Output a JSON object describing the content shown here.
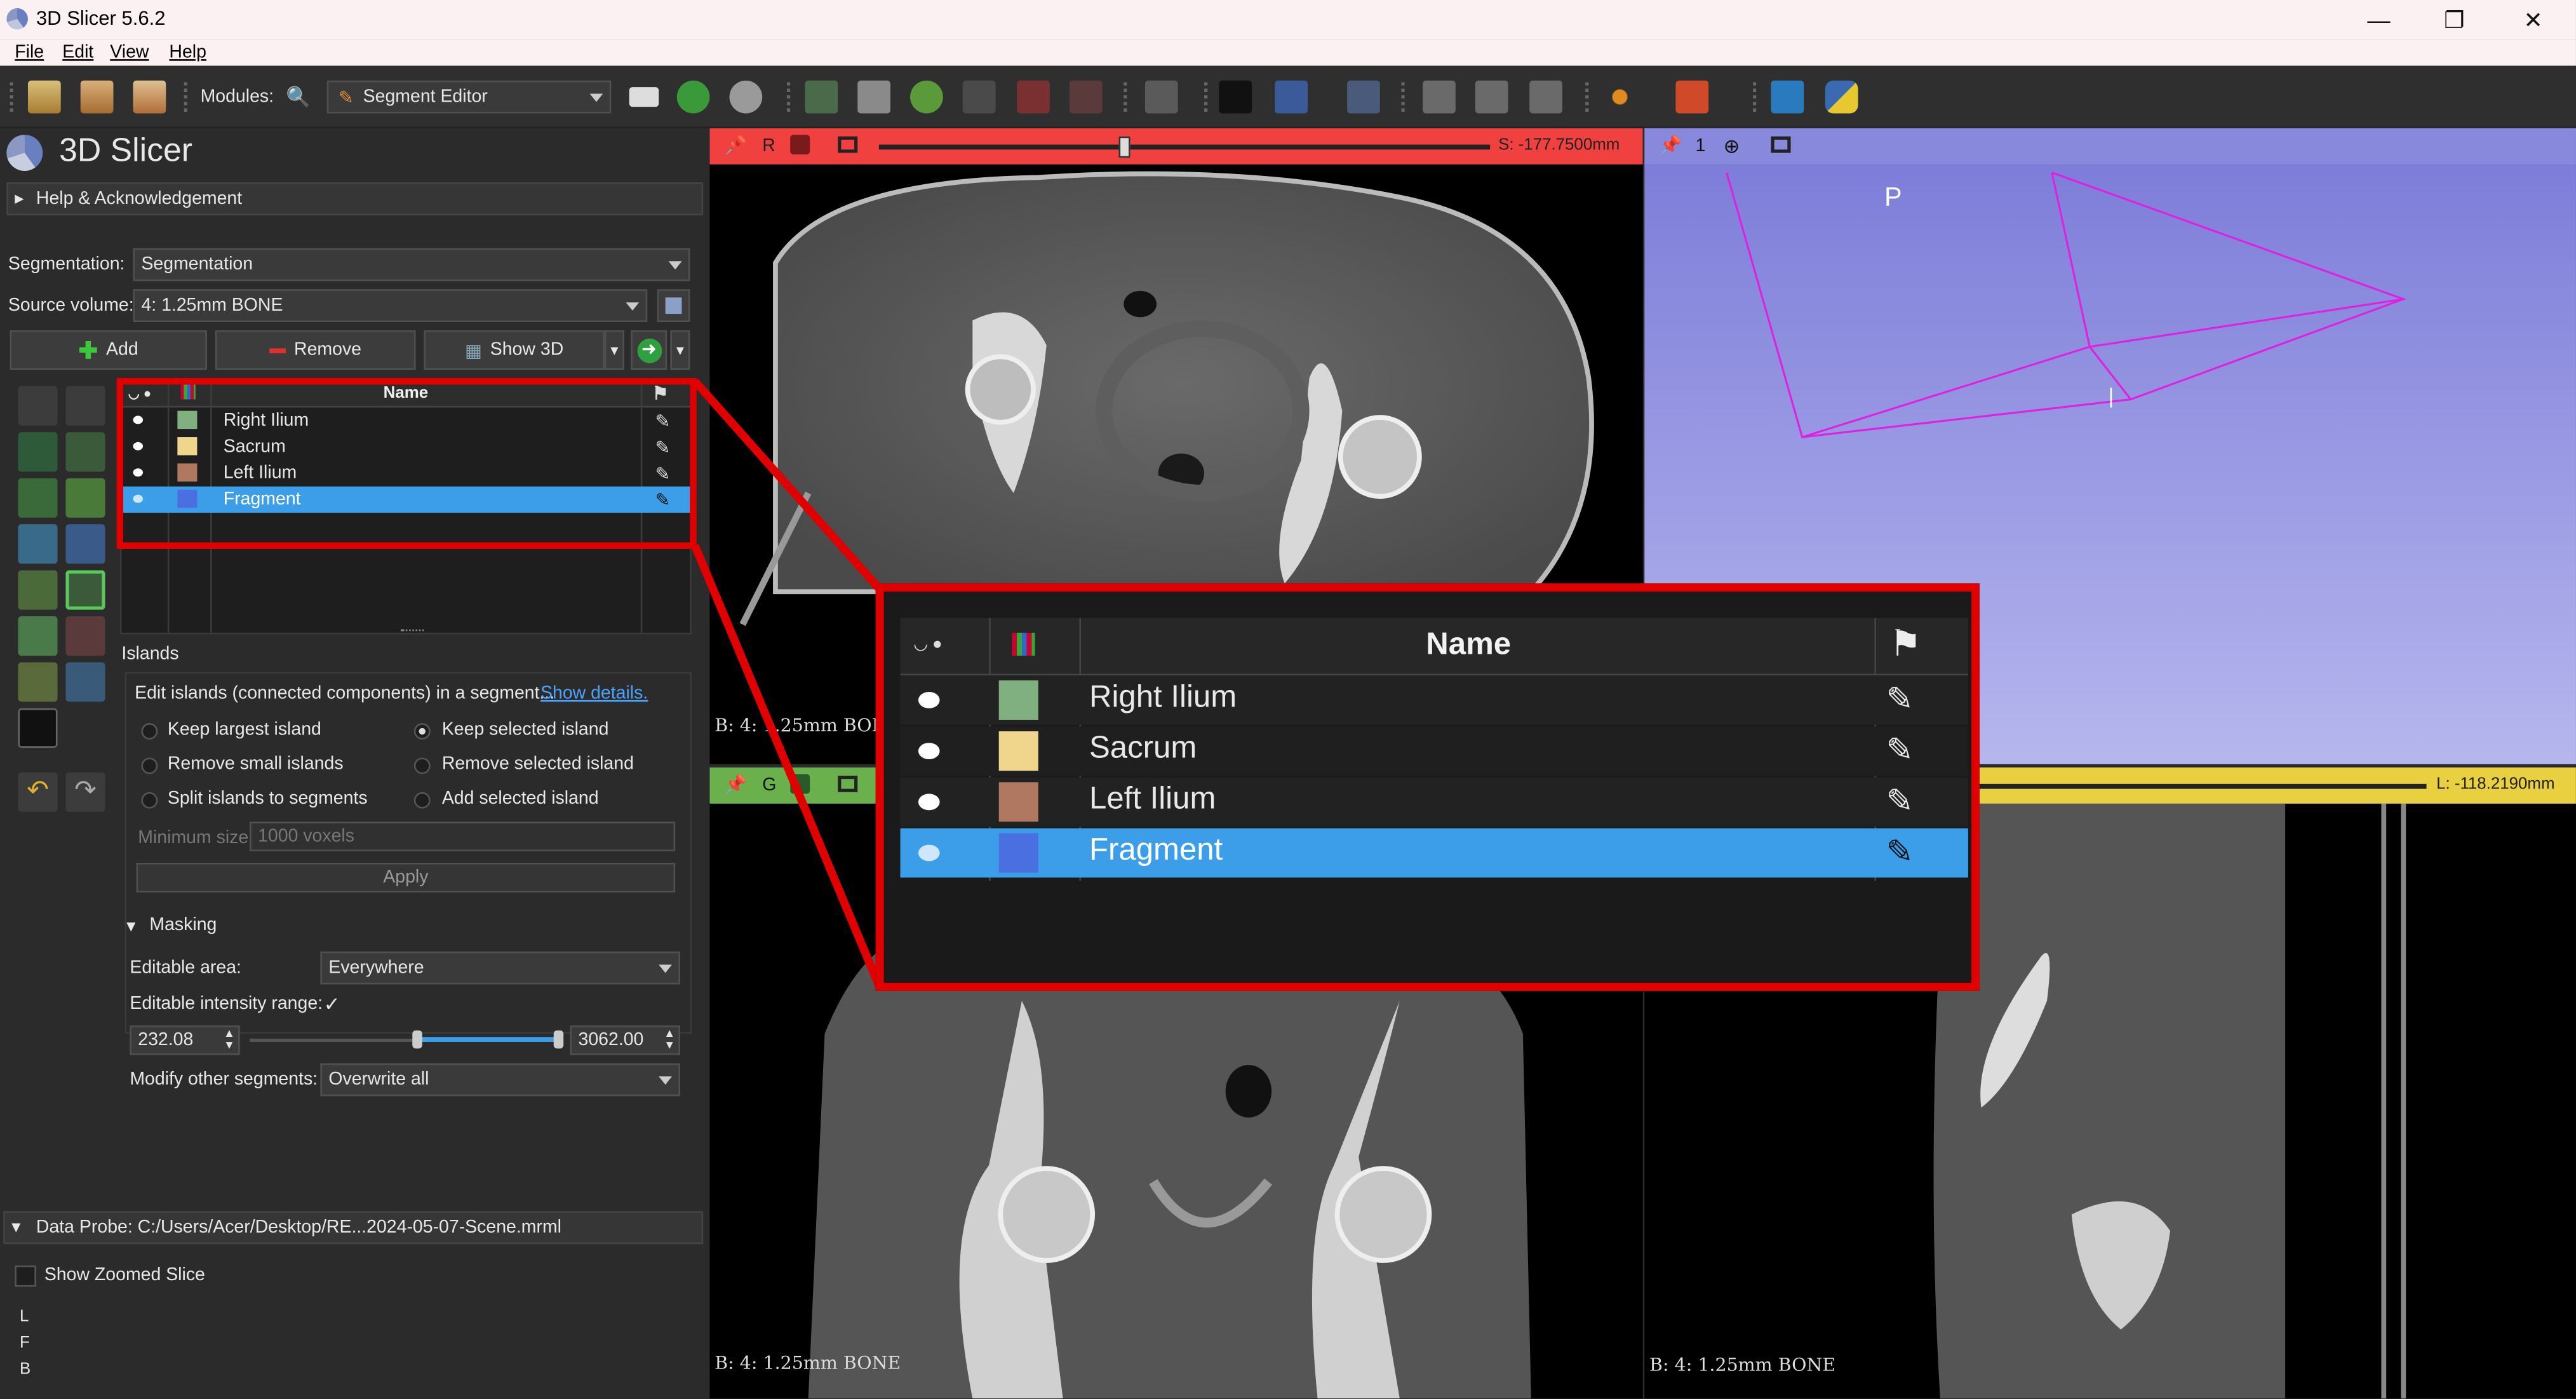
{
  "window": {
    "title": "3D Slicer 5.6.2",
    "minimize": "—",
    "restore": "❐",
    "close": "✕"
  },
  "menu": [
    "File",
    "Edit",
    "View",
    "Help"
  ],
  "toolbar": {
    "modules_label": "Modules:",
    "module_value": "Segment Editor",
    "icons": [
      "data-icon",
      "dcm-icon",
      "save-icon",
      "search-icon",
      "layout-icon",
      "back-icon",
      "forward-icon",
      "crosshair-icon",
      "python-icon"
    ]
  },
  "panel": {
    "app_name": "3D Slicer",
    "help_section": "Help & Acknowledgement",
    "segmentation_label": "Segmentation:",
    "segmentation_value": "Segmentation",
    "source_label": "Source volume:",
    "source_value": "4: 1.25mm BONE",
    "add_label": "Add",
    "remove_label": "Remove",
    "show3d_label": "Show 3D",
    "table_header_name": "Name",
    "segments": [
      {
        "name": "Right Ilium",
        "color": "#80b080"
      },
      {
        "name": "Sacrum",
        "color": "#f0d68c"
      },
      {
        "name": "Left Ilium",
        "color": "#b07860"
      },
      {
        "name": "Fragment",
        "color": "#4a6fe0"
      }
    ],
    "islands_title": "Islands",
    "islands_desc": "Edit islands (connected components) in a segment...",
    "show_details": "Show details.",
    "options": {
      "keep_largest": "Keep largest island",
      "keep_selected": "Keep selected island",
      "remove_small": "Remove small islands",
      "remove_selected": "Remove selected island",
      "split": "Split islands to segments",
      "add_selected": "Add selected island"
    },
    "min_size_label": "Minimum size:",
    "min_size_value": "1000 voxels",
    "apply_label": "Apply",
    "masking_title": "Masking",
    "editable_area_label": "Editable area:",
    "editable_area_value": "Everywhere",
    "intensity_label": "Editable intensity range:",
    "intensity_check": "✓",
    "range_min": "232.08",
    "range_max": "3062.00",
    "modify_label": "Modify other segments:",
    "modify_value": "Overwrite all",
    "data_probe": "Data Probe: C:/Users/Acer/Desktop/RE...2024-05-07-Scene.mrml",
    "show_zoomed": "Show Zoomed Slice",
    "probe_lines": [
      "L",
      "F",
      "B"
    ]
  },
  "views": {
    "red": {
      "letter": "R",
      "offset": "S: -177.7500mm",
      "corner": "B: 4: 1.25mm BONE",
      "color": "#f04040",
      "slider_fraction": 0.4
    },
    "green": {
      "letter": "G",
      "corner": "B: 4: 1.25mm BONE",
      "color": "#6ab04c"
    },
    "yellow": {
      "offset": "L: -118.2190mm",
      "corner": "B: 4: 1.25mm BONE",
      "color": "#e8d040"
    },
    "threed": {
      "number": "1",
      "orientation": "P",
      "color": "#8888dd"
    }
  },
  "zoom": {
    "header_name": "Name"
  }
}
